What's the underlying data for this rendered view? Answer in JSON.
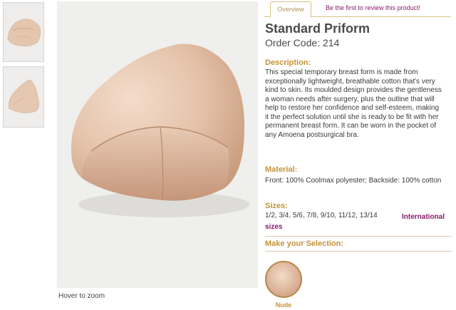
{
  "tabs": {
    "overview": "Overview",
    "review": "Be the first to review this product!"
  },
  "product": {
    "title": "Standard Priform",
    "order_code": "Order Code: 214"
  },
  "description": {
    "heading": "Description:",
    "text": "This special temporary breast form is made from exceptionally lightweight, breathable cotton that's very kind to skin. Its moulded design provides the gentleness a woman needs after surgery, plus the outline that will help to restore her confidence and self-esteem, making it the perfect solution until she is ready to be fit with her permanent breast form. It can be worn in the pocket of any Amoena postsurgical bra."
  },
  "material": {
    "heading": "Material:",
    "text": "Front: 100% Coolmax polyester; Backside: 100% cotton"
  },
  "sizes": {
    "heading": "Sizes:",
    "list": "1/2, 3/4, 5/6, 7/8, 9/10, 11/12, 13/14",
    "intl_link_1": "International",
    "intl_link_2": "sizes"
  },
  "selection": {
    "heading": "Make your Selection:",
    "swatch_label": "Nude",
    "swatch_color": "#dcb49a"
  },
  "image": {
    "hover_text": "Hover to zoom"
  },
  "colors": {
    "accent": "#c49238",
    "link": "#8b1a6b",
    "product": "#e2c2ab"
  }
}
